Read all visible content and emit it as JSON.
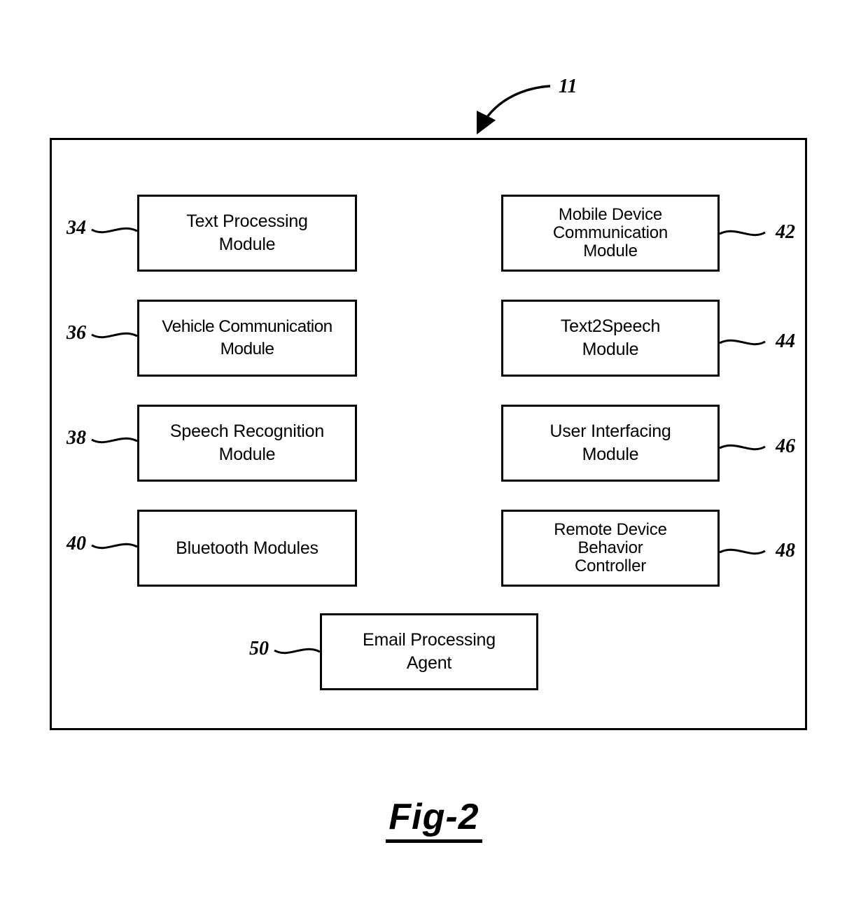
{
  "figure": {
    "caption": "Fig-2",
    "system_numeral": "11"
  },
  "diagram": {
    "type": "patent-block-diagram",
    "outer_container": {
      "name": "system-boundary",
      "numeral": "11"
    },
    "modules": [
      {
        "numeral": "34",
        "label": "Text Processing\nModule",
        "column": "left",
        "row": 1,
        "numeral_side": "left"
      },
      {
        "numeral": "36",
        "label": "Vehicle Communication\nModule",
        "column": "left",
        "row": 2,
        "numeral_side": "left"
      },
      {
        "numeral": "38",
        "label": "Speech Recognition\nModule",
        "column": "left",
        "row": 3,
        "numeral_side": "left"
      },
      {
        "numeral": "40",
        "label": "Bluetooth Modules",
        "column": "left",
        "row": 4,
        "numeral_side": "left"
      },
      {
        "numeral": "42",
        "label": "Mobile Device\nCommunication\nModule",
        "column": "right",
        "row": 1,
        "numeral_side": "right"
      },
      {
        "numeral": "44",
        "label": "Text2Speech\nModule",
        "column": "right",
        "row": 2,
        "numeral_side": "right"
      },
      {
        "numeral": "46",
        "label": "User Interfacing\nModule",
        "column": "right",
        "row": 3,
        "numeral_side": "right"
      },
      {
        "numeral": "48",
        "label": "Remote Device\nBehavior\nController",
        "column": "right",
        "row": 4,
        "numeral_side": "right"
      },
      {
        "numeral": "50",
        "label": "Email Processing\nAgent",
        "column": "center",
        "row": 5,
        "numeral_side": "left"
      }
    ]
  },
  "colors": {
    "stroke": "#000000",
    "background": "#ffffff"
  }
}
